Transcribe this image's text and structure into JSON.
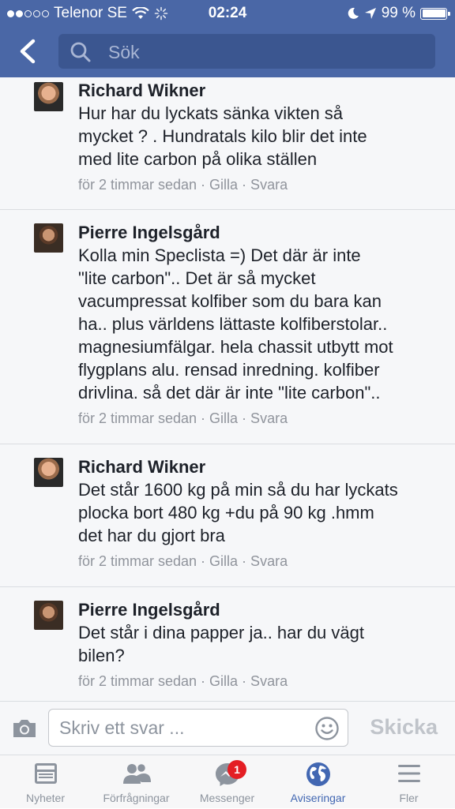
{
  "status_bar": {
    "carrier": "Telenor SE",
    "time": "02:24",
    "battery": "99 %"
  },
  "header": {
    "search_placeholder": "Sök"
  },
  "comments": [
    {
      "author": "Richard Wikner",
      "text": "Hur har du lyckats sänka vikten så\nmycket ? . Hundratals kilo blir det inte\nmed lite carbon på olika ställen",
      "meta": "för 2 timmar sedan · Gilla · Svara"
    },
    {
      "author": "Pierre Ingelsgård",
      "text": "Kolla min Speclista =)  Det där är inte\n\"lite carbon\".. Det är så mycket\nvacumpressat kolfiber som du bara kan\nha.. plus världens lättaste kolfiberstolar..\nmagnesiumfälgar. hela chassit utbytt mot\nflygplans alu. rensad inredning. kolfiber\ndrivlina.  så det där är inte \"lite carbon\"..",
      "meta": "för 2 timmar sedan · Gilla · Svara"
    },
    {
      "author": "Richard Wikner",
      "text": "Det står 1600 kg på min så du har lyckats\nplocka bort 480 kg +du på 90 kg .hmm\ndet har du gjort bra",
      "meta": "för 2 timmar sedan · Gilla · Svara"
    },
    {
      "author": "Pierre Ingelsgård",
      "text": "Det står i dina papper ja.. har du vägt\nbilen?",
      "meta": "för 2 timmar sedan · Gilla · Svara"
    }
  ],
  "composer": {
    "placeholder": "Skriv ett svar ...",
    "send_label": "Skicka"
  },
  "tabs": [
    {
      "label": "Nyheter",
      "icon": "news-feed-icon"
    },
    {
      "label": "Förfrågningar",
      "icon": "friend-requests-icon"
    },
    {
      "label": "Messenger",
      "icon": "messenger-icon",
      "badge": "1"
    },
    {
      "label": "Aviseringar",
      "icon": "globe-icon",
      "active": true
    },
    {
      "label": "Fler",
      "icon": "menu-icon"
    }
  ],
  "colors": {
    "header_bg": "#4a67a6",
    "search_bg": "#3b5690",
    "accent": "#4267b2",
    "badge": "#e41e24",
    "meta_text": "#90949c"
  }
}
